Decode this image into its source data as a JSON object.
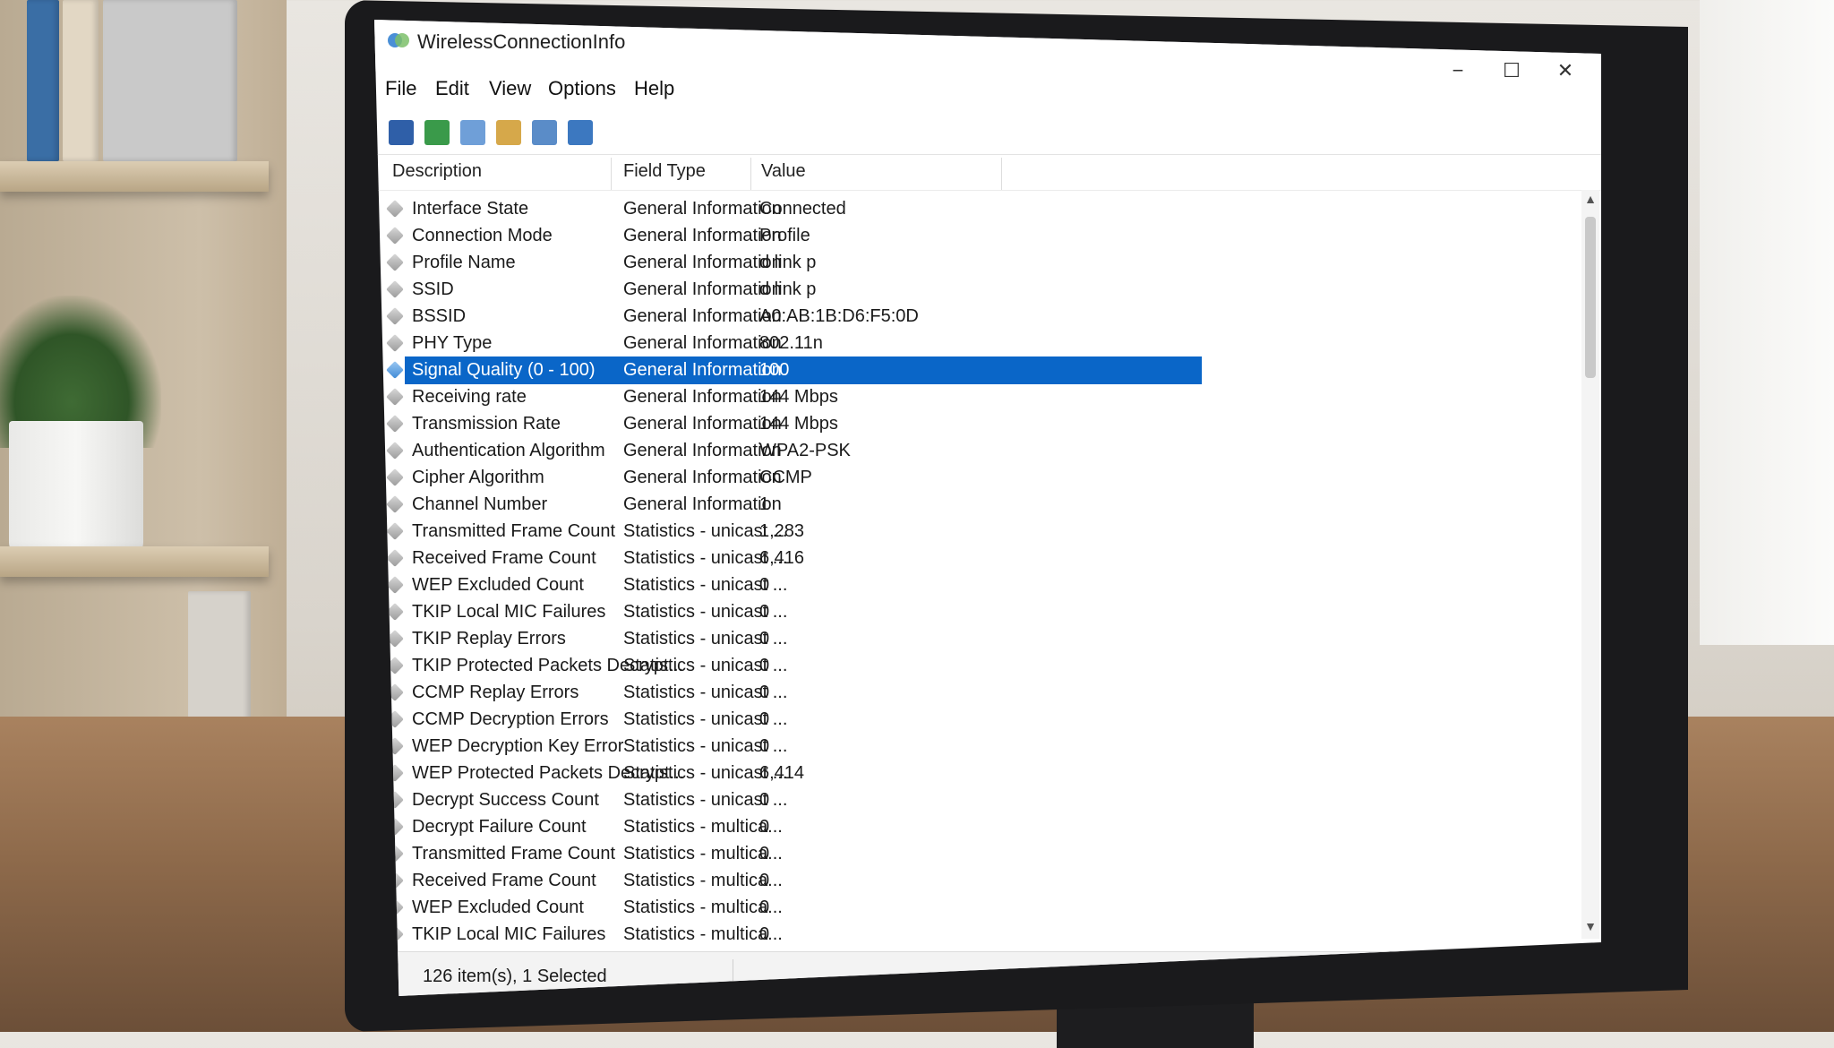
{
  "window": {
    "title": "WirelessConnectionInfo",
    "minimize": "−",
    "maximize": "☐",
    "close": "✕"
  },
  "menu": [
    "File",
    "Edit",
    "View",
    "Options",
    "Help"
  ],
  "toolbar": [
    "save-icon",
    "refresh-icon",
    "copy-icon",
    "properties-icon",
    "html-report-icon",
    "exit-icon"
  ],
  "columns": {
    "description": "Description",
    "field_type": "Field Type",
    "value": "Value"
  },
  "rows": [
    {
      "d": "Interface State",
      "t": "General Information",
      "v": "Connected"
    },
    {
      "d": "Connection Mode",
      "t": "General Information",
      "v": "Profile"
    },
    {
      "d": "Profile Name",
      "t": "General Information",
      "v": "d link p"
    },
    {
      "d": "SSID",
      "t": "General Information",
      "v": "d link p"
    },
    {
      "d": "BSSID",
      "t": "General Information",
      "v": "A0:AB:1B:D6:F5:0D"
    },
    {
      "d": "PHY Type",
      "t": "General Information",
      "v": "802.11n"
    },
    {
      "d": "Signal Quality (0 - 100)",
      "t": "General Information",
      "v": "100",
      "selected": true
    },
    {
      "d": "Receiving rate",
      "t": "General Information",
      "v": "144 Mbps"
    },
    {
      "d": "Transmission Rate",
      "t": "General Information",
      "v": "144 Mbps"
    },
    {
      "d": "Authentication Algorithm",
      "t": "General Information",
      "v": "WPA2-PSK"
    },
    {
      "d": "Cipher Algorithm",
      "t": "General Information",
      "v": "CCMP"
    },
    {
      "d": "Channel Number",
      "t": "General Information",
      "v": "1"
    },
    {
      "d": "Transmitted Frame Count",
      "t": "Statistics - unicast ...",
      "v": "1,283"
    },
    {
      "d": "Received Frame Count",
      "t": "Statistics - unicast ...",
      "v": "6,416"
    },
    {
      "d": "WEP Excluded Count",
      "t": "Statistics - unicast ...",
      "v": "0"
    },
    {
      "d": "TKIP Local MIC Failures",
      "t": "Statistics - unicast ...",
      "v": "0"
    },
    {
      "d": "TKIP Replay Errors",
      "t": "Statistics - unicast ...",
      "v": "0"
    },
    {
      "d": "TKIP Protected Packets Decrypt...",
      "t": "Statistics - unicast ...",
      "v": "0"
    },
    {
      "d": "CCMP Replay Errors",
      "t": "Statistics - unicast ...",
      "v": "0"
    },
    {
      "d": "CCMP Decryption Errors",
      "t": "Statistics - unicast ...",
      "v": "0"
    },
    {
      "d": "WEP Decryption Key Error",
      "t": "Statistics - unicast ...",
      "v": "0"
    },
    {
      "d": "WEP Protected Packets Decrypt...",
      "t": "Statistics - unicast ...",
      "v": "6,414"
    },
    {
      "d": "Decrypt Success Count",
      "t": "Statistics - unicast ...",
      "v": "0"
    },
    {
      "d": "Decrypt Failure Count",
      "t": "Statistics - multica...",
      "v": "0"
    },
    {
      "d": "Transmitted Frame Count",
      "t": "Statistics - multica...",
      "v": "0"
    },
    {
      "d": "Received Frame Count",
      "t": "Statistics - multica...",
      "v": "0"
    },
    {
      "d": "WEP Excluded Count",
      "t": "Statistics - multica...",
      "v": "0"
    },
    {
      "d": "TKIP Local MIC Failures",
      "t": "Statistics - multica...",
      "v": "0"
    }
  ],
  "status": "126 item(s), 1 Selected",
  "colors": {
    "selection": "#0a66c8"
  }
}
